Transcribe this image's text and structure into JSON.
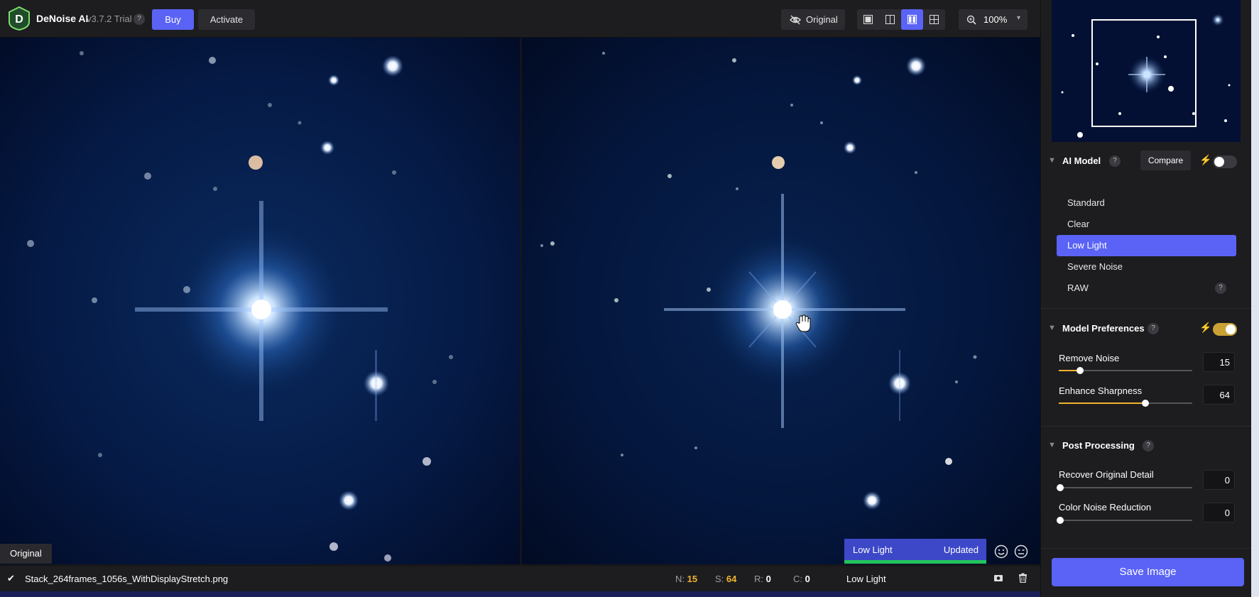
{
  "app": {
    "name": "DeNoise AI",
    "version": "v3.7.2 Trial",
    "logo_letter": "D",
    "help": "?"
  },
  "toolbar": {
    "buy_label": "Buy",
    "activate_label": "Activate",
    "original_label": "Original",
    "zoom_label": "100%",
    "active_view": "side-by-side"
  },
  "viewer": {
    "left_tag": "Original",
    "model_tag": "Low Light",
    "model_status": "Updated"
  },
  "status": {
    "filename": "Stack_264frames_1056s_WithDisplayStretch.png",
    "n_label": "N:",
    "n_value": "15",
    "s_label": "S:",
    "s_value": "64",
    "r_label": "R:",
    "r_value": "0",
    "c_label": "C:",
    "c_value": "0",
    "model": "Low Light"
  },
  "sidebar": {
    "ai_model": {
      "title": "AI Model",
      "compare_label": "Compare",
      "auto_enabled": false,
      "items": [
        {
          "label": "Standard",
          "active": false
        },
        {
          "label": "Clear",
          "active": false
        },
        {
          "label": "Low Light",
          "active": true
        },
        {
          "label": "Severe Noise",
          "active": false
        },
        {
          "label": "RAW",
          "active": false
        }
      ]
    },
    "model_prefs": {
      "title": "Model Preferences",
      "auto_enabled": true,
      "remove_noise_label": "Remove Noise",
      "remove_noise_value": "15",
      "enhance_sharpness_label": "Enhance Sharpness",
      "enhance_sharpness_value": "64"
    },
    "post_processing": {
      "title": "Post Processing",
      "recover_label": "Recover Original Detail",
      "recover_value": "0",
      "color_noise_label": "Color Noise Reduction",
      "color_noise_value": "0"
    },
    "save_label": "Save Image"
  },
  "colors": {
    "accent": "#5a63f5",
    "slider_fill": "#f2b32c",
    "progress_green": "#22c35e",
    "toggle_on": "#c9a233"
  }
}
